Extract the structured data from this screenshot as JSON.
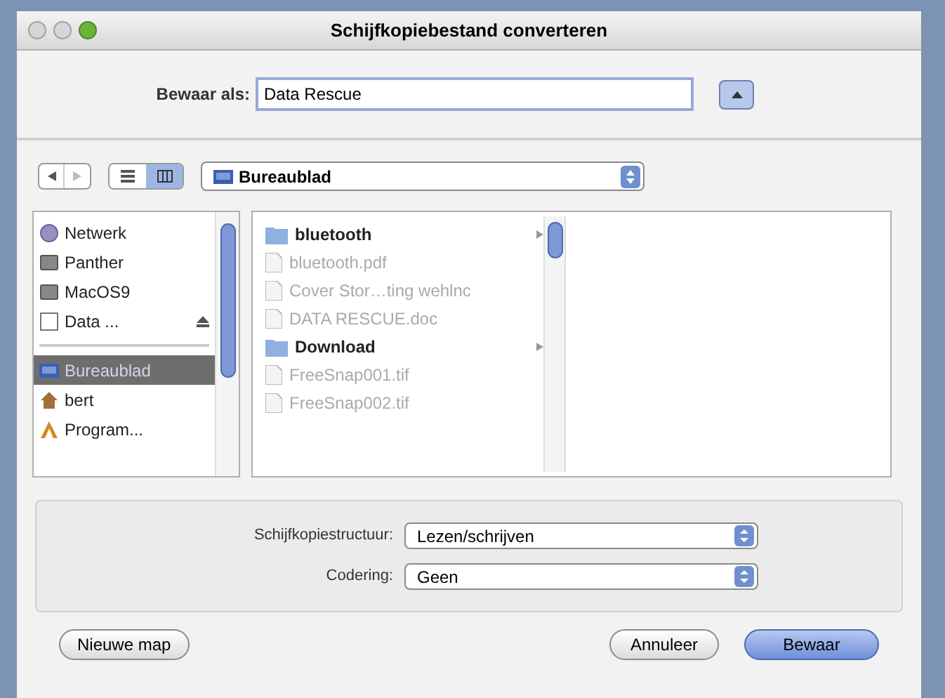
{
  "window": {
    "title": "Schijfkopiebestand converteren"
  },
  "save_as": {
    "label": "Bewaar als:",
    "value": "Data Rescue",
    "expanded": true
  },
  "location": {
    "value": "Bureaublad"
  },
  "view_mode": [
    {
      "kind": "list",
      "selected": false
    },
    {
      "kind": "columns",
      "selected": true
    }
  ],
  "sidebar": {
    "items": [
      {
        "label": "Netwerk",
        "kind": "network",
        "selected": false
      },
      {
        "label": "Panther",
        "kind": "disk",
        "selected": false
      },
      {
        "label": "MacOS9",
        "kind": "disk",
        "selected": false
      },
      {
        "label": "Data ...",
        "kind": "removable",
        "selected": false
      },
      {
        "label": "Bureaublad",
        "kind": "desktop",
        "selected": true
      },
      {
        "label": "bert",
        "kind": "home",
        "selected": false
      },
      {
        "label": "Program...",
        "kind": "apps",
        "selected": false
      }
    ]
  },
  "files": [
    {
      "name": "bluetooth",
      "kind": "folder",
      "enabled": true
    },
    {
      "name": "bluetooth.pdf",
      "kind": "file",
      "enabled": false
    },
    {
      "name": "Cover Stor…ting wehlnc",
      "kind": "file",
      "enabled": false
    },
    {
      "name": "DATA RESCUE.doc",
      "kind": "file",
      "enabled": false
    },
    {
      "name": "Download",
      "kind": "folder",
      "enabled": true
    },
    {
      "name": "FreeSnap001.tif",
      "kind": "file",
      "enabled": false
    },
    {
      "name": "FreeSnap002.tif",
      "kind": "file",
      "enabled": false
    }
  ],
  "options": [
    {
      "label": "Schijfkopiestructuur:",
      "value": "Lezen/schrijven"
    },
    {
      "label": "Codering:",
      "value": "Geen"
    }
  ],
  "buttons": {
    "new_folder": "Nieuwe map",
    "cancel": "Annuleer",
    "save": "Bewaar"
  }
}
